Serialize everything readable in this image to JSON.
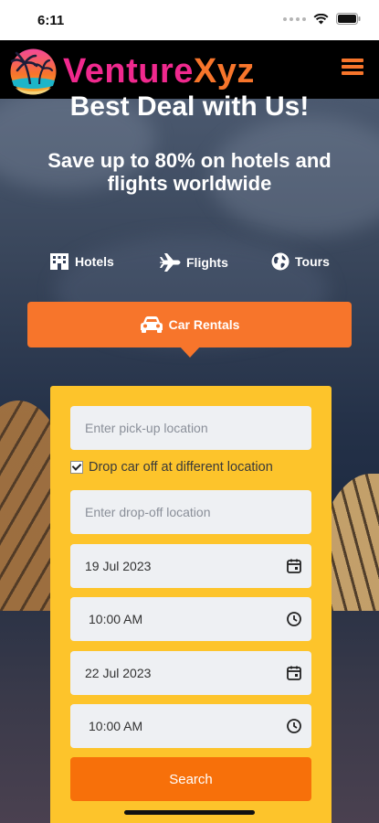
{
  "status_bar": {
    "time": "6:11"
  },
  "header": {
    "brand_part1": "Venture",
    "brand_part2": "Xyz",
    "menu_icon": "hamburger-icon",
    "brand_color": "#f0298e",
    "accent_color": "#f7752b"
  },
  "hero": {
    "title": "Best Deal with Us!",
    "subtitle": "Save up to 80% on hotels and flights worldwide"
  },
  "tabs": [
    {
      "label": "Hotels",
      "icon": "hotel-icon"
    },
    {
      "label": "Flights",
      "icon": "plane-icon"
    },
    {
      "label": "Tours",
      "icon": "globe-icon"
    }
  ],
  "active_tab": {
    "label": "Car Rentals",
    "icon": "car-icon"
  },
  "form": {
    "pickup_placeholder": "Enter pick-up location",
    "dropoff_checkbox_label": "Drop car off at different location",
    "dropoff_checked": true,
    "dropoff_placeholder": "Enter drop-off location",
    "pickup_date": "19 Jul 2023",
    "pickup_time": "10:00 AM",
    "dropoff_date": "22 Jul 2023",
    "dropoff_time": "10:00 AM",
    "search_label": "Search",
    "card_color": "#fdc42b",
    "button_color": "#f7700a"
  }
}
